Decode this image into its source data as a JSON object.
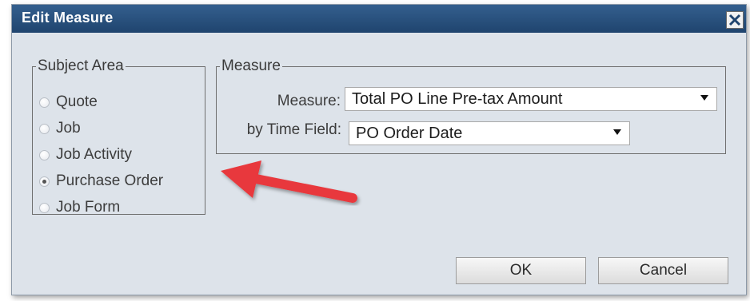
{
  "dialog": {
    "title": "Edit Measure",
    "close_icon": "close-x-icon"
  },
  "subject_area": {
    "legend": "Subject Area",
    "options": [
      {
        "label": "Quote",
        "checked": false
      },
      {
        "label": "Job",
        "checked": false
      },
      {
        "label": "Job Activity",
        "checked": false
      },
      {
        "label": "Purchase Order",
        "checked": true
      },
      {
        "label": "Job Form",
        "checked": false
      }
    ]
  },
  "measure": {
    "legend": "Measure",
    "measure_label": "Measure:",
    "measure_value": "Total PO Line Pre-tax Amount",
    "time_label": "by Time Field:",
    "time_value": "PO Order Date"
  },
  "buttons": {
    "ok": "OK",
    "cancel": "Cancel"
  },
  "annotation": {
    "arrow_color": "#e8393c"
  }
}
